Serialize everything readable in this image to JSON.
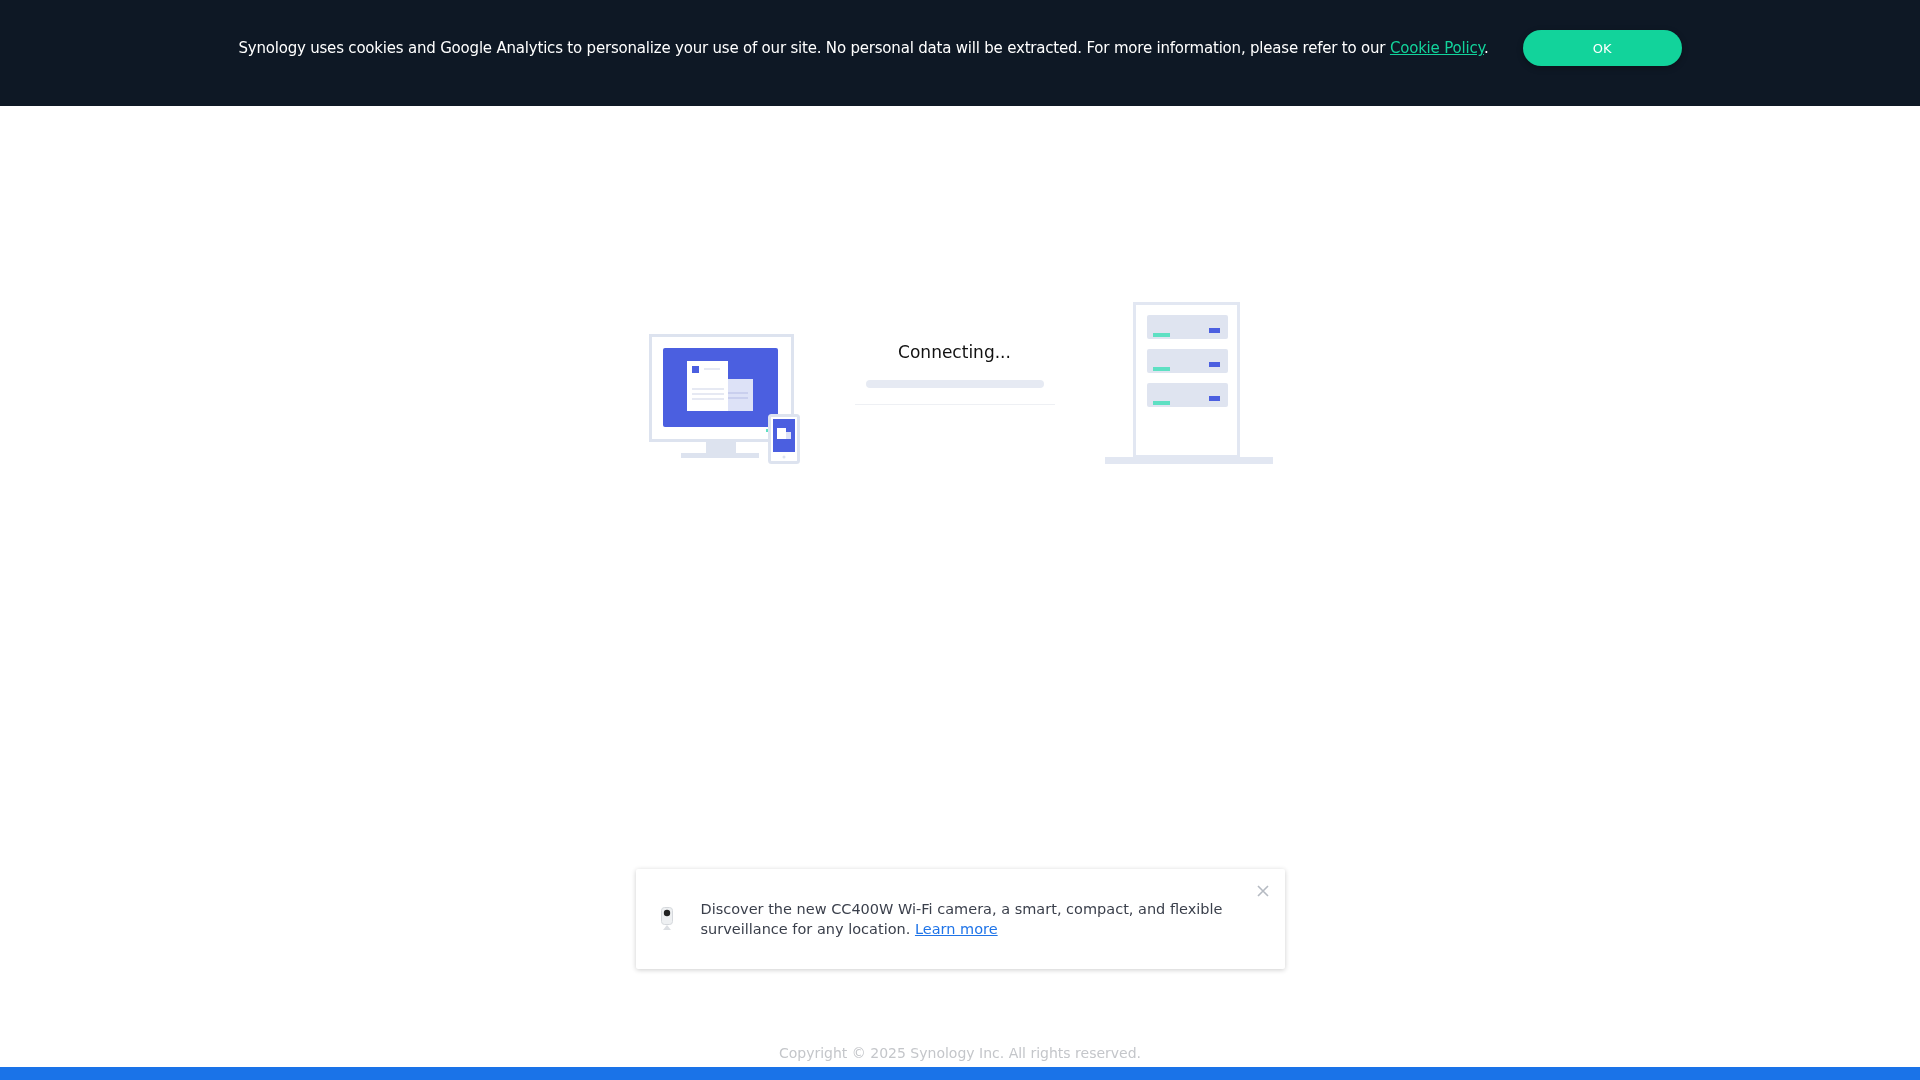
{
  "cookie_banner": {
    "message": "Synology uses cookies and Google Analytics to personalize your use of our site. No personal data will be extracted. For more information, please refer to our ",
    "link": "Cookie Policy",
    "message_end": ".",
    "button": "OK"
  },
  "connection": {
    "status": "Connecting...",
    "level": 0
  },
  "notification": {
    "message": "Discover the new CC400W Wi-Fi camera, a smart, compact, and flexible surveillance for any location. ",
    "link": "Learn more"
  },
  "footer": {
    "copyright": "Copyright © 2025 Synology Inc. All rights reserved."
  }
}
